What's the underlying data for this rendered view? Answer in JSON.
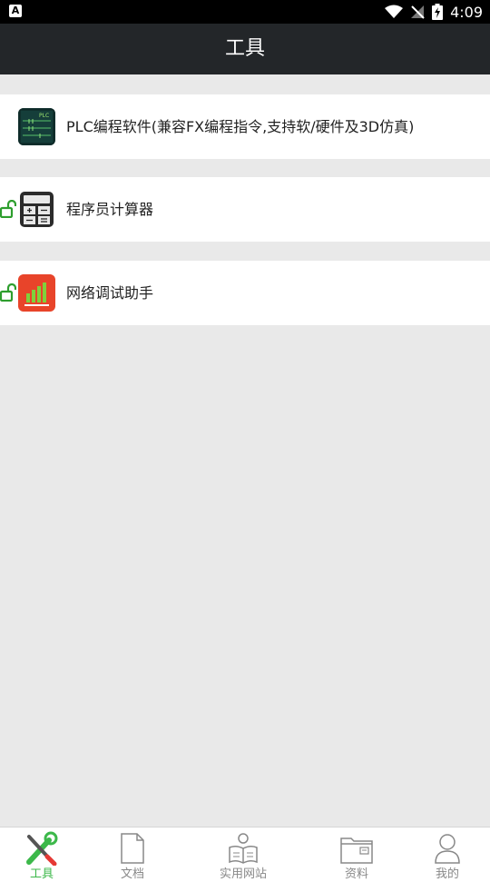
{
  "status_bar": {
    "notification_icon": "a-app-icon",
    "time": "4:09",
    "icons": [
      "wifi-icon",
      "no-signal-icon",
      "battery-charging-icon"
    ]
  },
  "header": {
    "title": "工具"
  },
  "tools": [
    {
      "label": "PLC编程软件(兼容FX编程指令,支持软/硬件及3D仿真)",
      "icon": "plc-app-icon",
      "locked": false
    },
    {
      "label": "程序员计算器",
      "icon": "calculator-app-icon",
      "locked": true
    },
    {
      "label": "网络调试助手",
      "icon": "network-debug-app-icon",
      "locked": true
    }
  ],
  "plc_icon_text": "PLC",
  "tab_bar": {
    "tabs": [
      {
        "label": "工具",
        "icon": "tools-icon",
        "active": true
      },
      {
        "label": "文档",
        "icon": "document-icon",
        "active": false
      },
      {
        "label": "实用网站",
        "icon": "reader-icon",
        "active": false
      },
      {
        "label": "资料",
        "icon": "folder-icon",
        "active": false
      },
      {
        "label": "我的",
        "icon": "user-icon",
        "active": false
      }
    ]
  },
  "colors": {
    "appbar": "#232629",
    "accent_green": "#3cb84a",
    "lock_green": "#2e9e2e",
    "network_icon_bg": "#e8442a"
  }
}
